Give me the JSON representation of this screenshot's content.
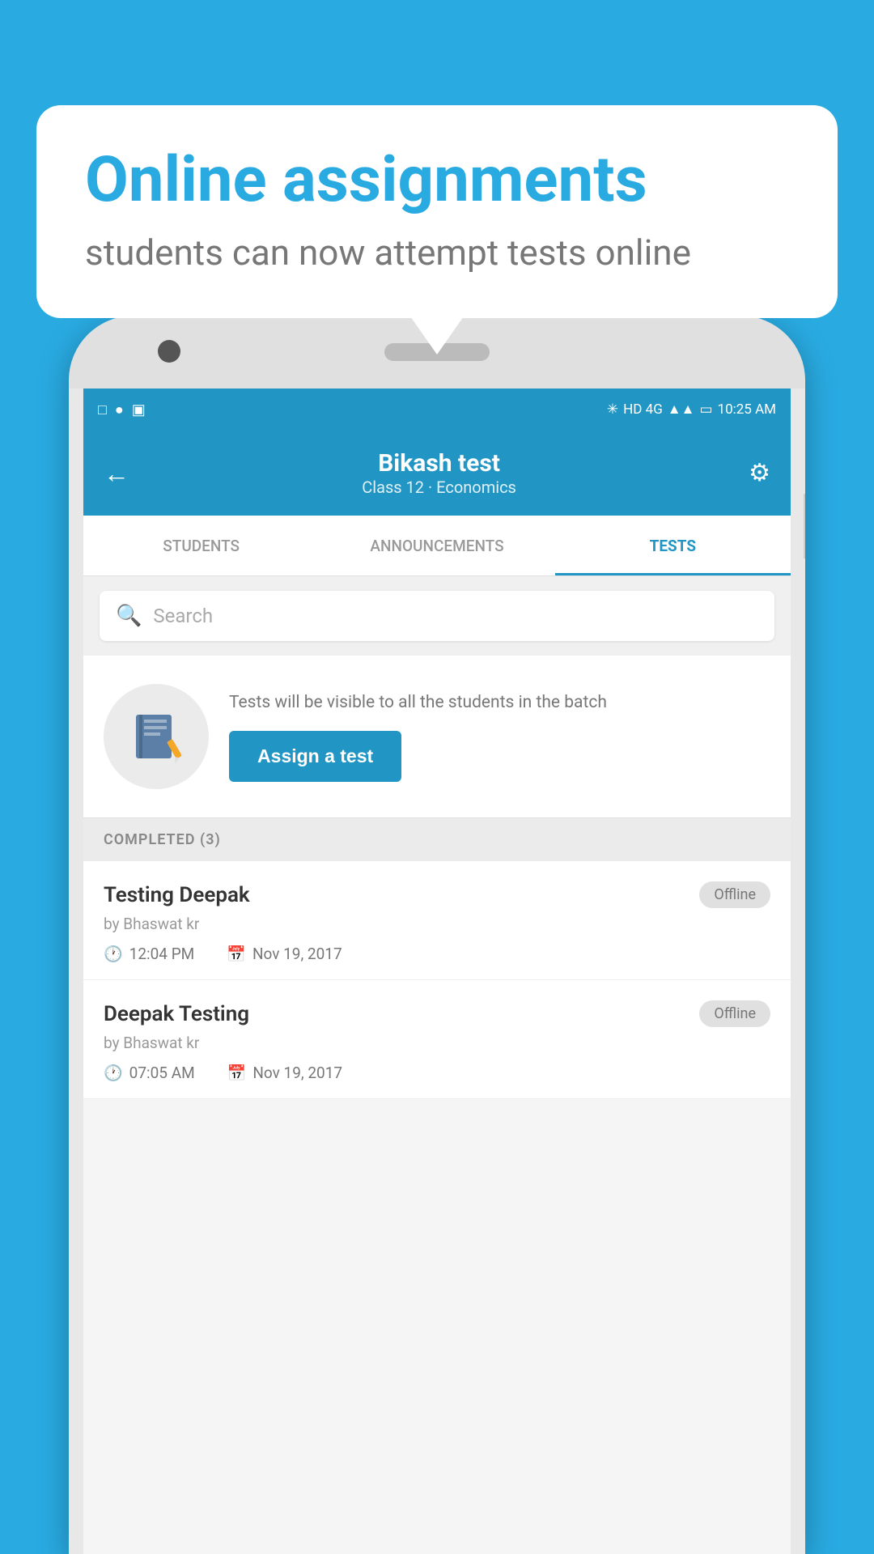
{
  "background": {
    "color": "#29ABE2"
  },
  "speech_bubble": {
    "title": "Online assignments",
    "subtitle": "students can now attempt tests online"
  },
  "status_bar": {
    "time": "10:25 AM",
    "network": "HD 4G"
  },
  "app_bar": {
    "back_label": "←",
    "title": "Bikash test",
    "subtitle": "Class 12 · Economics",
    "settings_label": "⚙"
  },
  "tabs": [
    {
      "label": "STUDENTS",
      "active": false
    },
    {
      "label": "ANNOUNCEMENTS",
      "active": false
    },
    {
      "label": "TESTS",
      "active": true
    }
  ],
  "search": {
    "placeholder": "Search"
  },
  "assign_section": {
    "description": "Tests will be visible to all the students in the batch",
    "button_label": "Assign a test"
  },
  "completed_section": {
    "header": "COMPLETED (3)",
    "items": [
      {
        "name": "Testing Deepak",
        "status": "Offline",
        "author": "by Bhaswat kr",
        "time": "12:04 PM",
        "date": "Nov 19, 2017"
      },
      {
        "name": "Deepak Testing",
        "status": "Offline",
        "author": "by Bhaswat kr",
        "time": "07:05 AM",
        "date": "Nov 19, 2017"
      }
    ]
  }
}
